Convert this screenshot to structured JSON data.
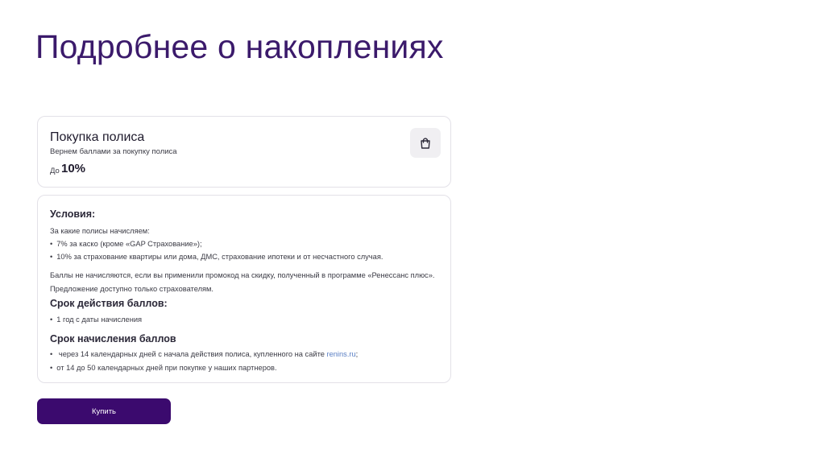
{
  "slide": {
    "title": "Подробнее о накоплениях"
  },
  "policy_card": {
    "title": "Покупка полиса",
    "subtitle": "Вернем баллами за покупку полиса",
    "value_prefix": "До",
    "value": "10%",
    "icon": "shopping-bag-icon"
  },
  "conditions": {
    "heading": "Условия:",
    "intro": "За какие полисы начисляем:",
    "policies": [
      "7% за каско (кроме «GAP Страхование»);",
      "10% за страхование квартиры или дома, ДМС, страхование ипотеки и от несчастного случая."
    ],
    "note_line1": "Баллы не начисляются, если вы применили промокод на скидку, полученный в программе «Ренессанс плюс».",
    "note_line2": "Предложение доступно только страхователям.",
    "validity_heading": "Срок действия баллов:",
    "validity_items": [
      "1 год с даты начисления"
    ],
    "accrual_heading": "Срок начисления баллов",
    "accrual_item1_text": "через 14 календарных дней с начала действия полиса, купленного на сайте",
    "accrual_item1_link": "renins.ru",
    "accrual_item1_end": ";",
    "accrual_item2": "от 14 до 50 календарных дней при покупке у наших партнеров."
  },
  "buy_button": {
    "label": "Купить"
  },
  "colors": {
    "title": "#3b1a6b",
    "button": "#3b0a6e",
    "link": "#5a7fc4"
  }
}
